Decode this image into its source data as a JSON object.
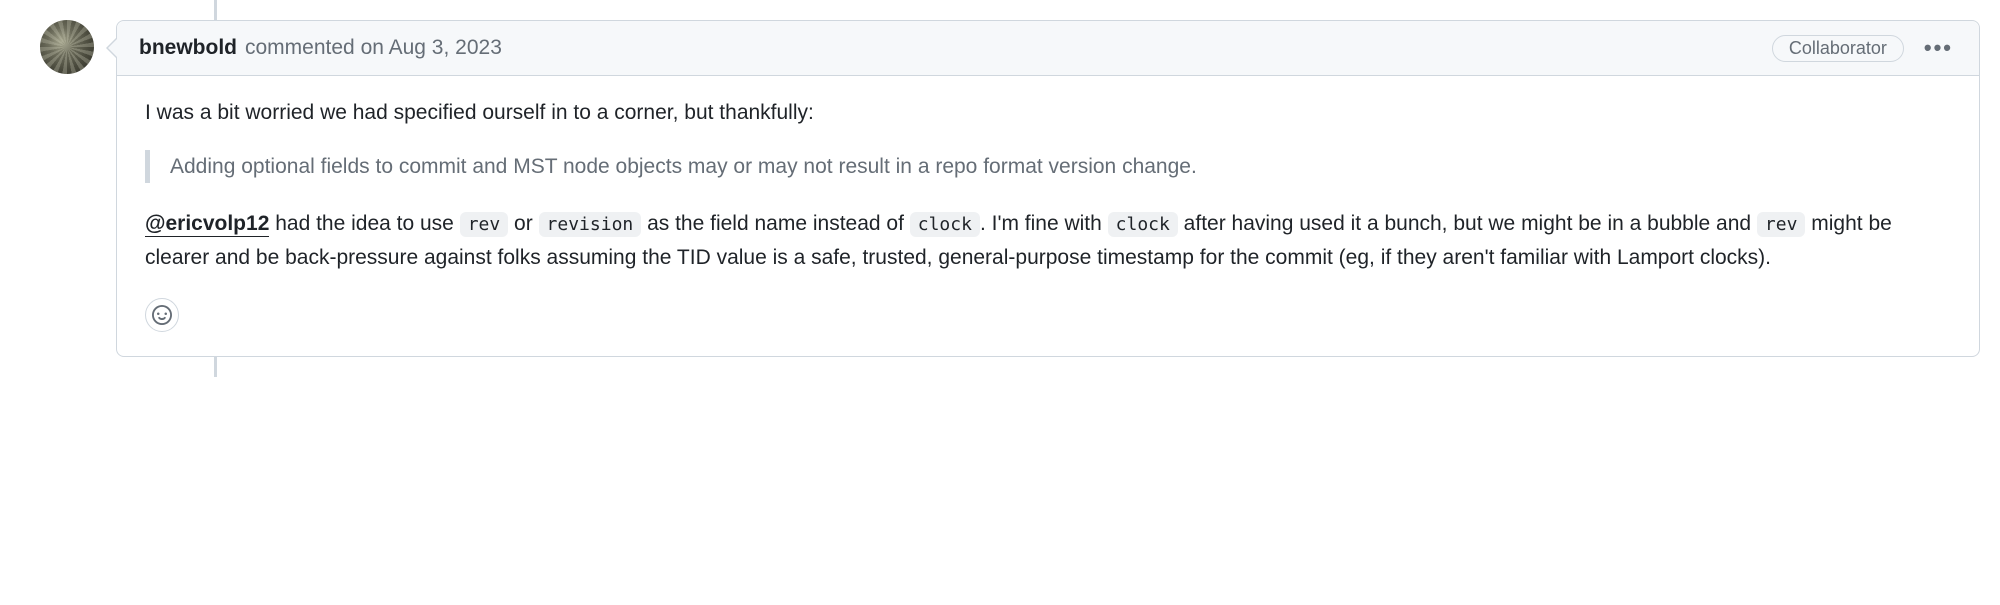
{
  "comment": {
    "author": "bnewbold",
    "commented_label": "commented",
    "on_label": "on",
    "timestamp": "Aug 3, 2023",
    "badge": "Collaborator",
    "body": {
      "p1": "I was a bit worried we had specified ourself in to a corner, but thankfully:",
      "quote": "Adding optional fields to commit and MST node objects may or may not result in a repo format version change.",
      "mention": "@ericvolp12",
      "p2_a": " had the idea to use ",
      "code_rev": "rev",
      "p2_b": " or ",
      "code_revision": "revision",
      "p2_c": " as the field name instead of ",
      "code_clock1": "clock",
      "p2_d": ". I'm fine with ",
      "code_clock2": "clock",
      "p2_e": " after having used it a bunch, but we might be in a bubble and ",
      "code_rev2": "rev",
      "p2_f": " might be clearer and be back-pressure against folks assuming the TID value is a safe, trusted, general-purpose timestamp for the commit (eg, if they aren't familiar with Lamport clocks)."
    }
  }
}
